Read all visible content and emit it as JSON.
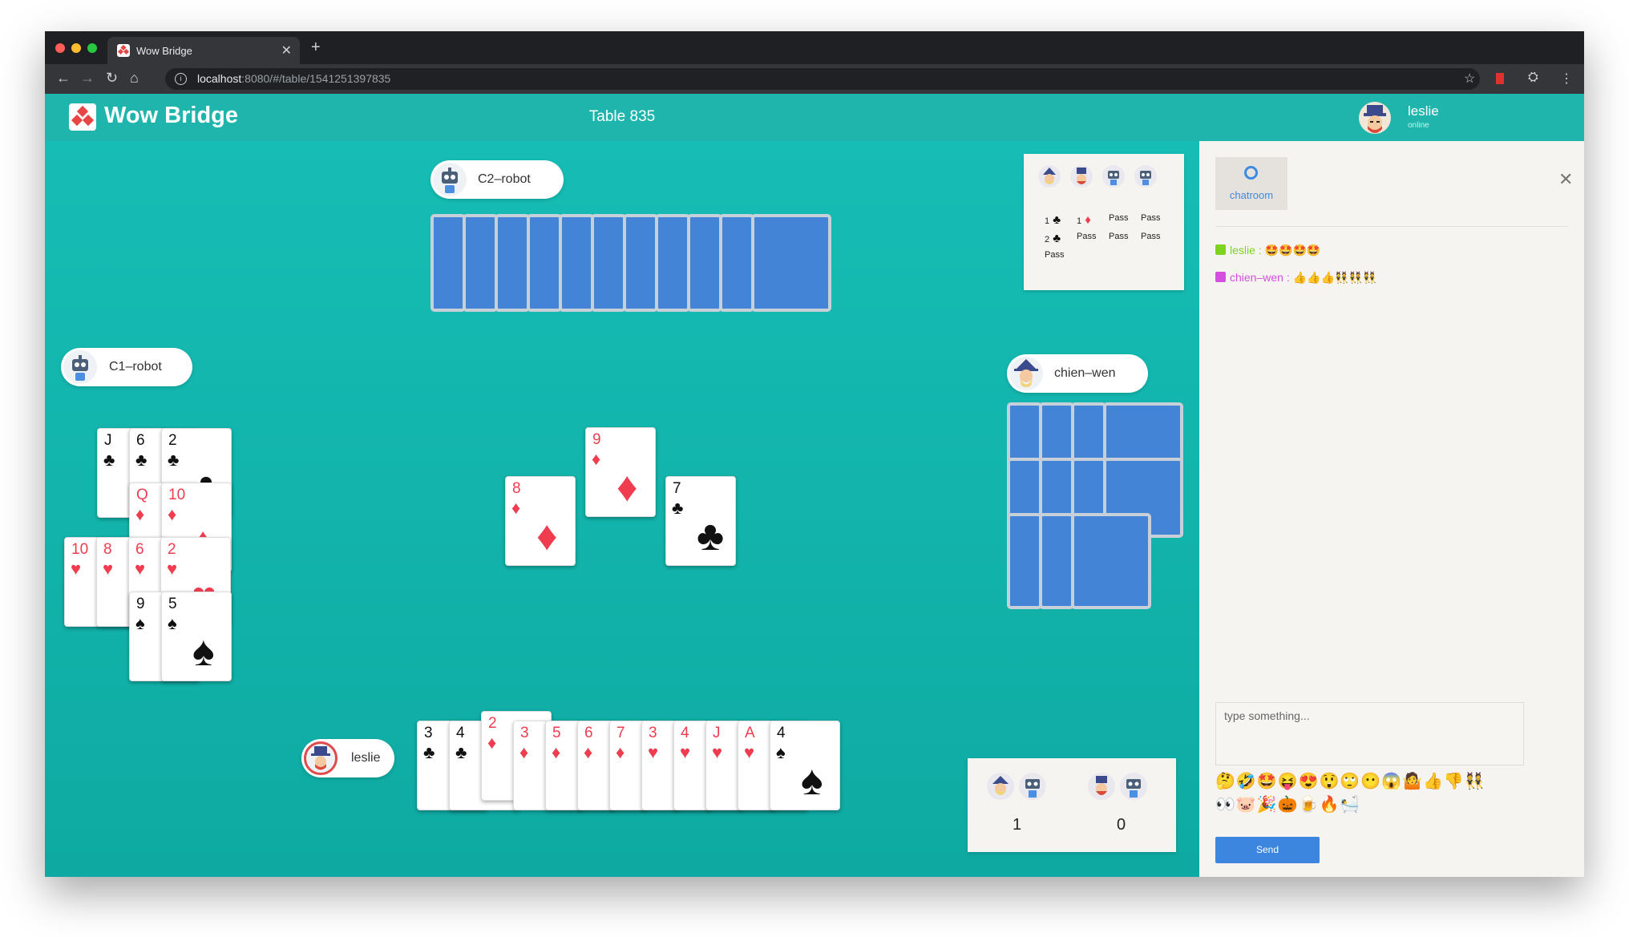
{
  "browser": {
    "tab_title": "Wow Bridge",
    "url_host": "localhost",
    "url_rest": ":8080/#/table/1541251397835"
  },
  "app": {
    "brand": "Wow Bridge",
    "table_title": "Table 835",
    "user_name": "leslie",
    "user_status": "online"
  },
  "players": {
    "north": "C2–robot",
    "west": "C1–robot",
    "east": "chien–wen",
    "south": "leslie"
  },
  "colors": {
    "felt": "#16bdb4",
    "card_back": "#4384d6",
    "red_suit": "#ef3d4f",
    "accent": "#3d86e0"
  },
  "west_hand": [
    {
      "rank": "J",
      "suit": "♣",
      "color": "blk"
    },
    {
      "rank": "6",
      "suit": "♣",
      "color": "blk"
    },
    {
      "rank": "2",
      "suit": "♣",
      "color": "blk"
    },
    {
      "rank": "Q",
      "suit": "♦",
      "color": "red"
    },
    {
      "rank": "10",
      "suit": "♦",
      "color": "red"
    },
    {
      "rank": "10",
      "suit": "♥",
      "color": "red"
    },
    {
      "rank": "8",
      "suit": "♥",
      "color": "red"
    },
    {
      "rank": "6",
      "suit": "♥",
      "color": "red"
    },
    {
      "rank": "2",
      "suit": "♥",
      "color": "red"
    },
    {
      "rank": "9",
      "suit": "♠",
      "color": "blk"
    },
    {
      "rank": "5",
      "suit": "♠",
      "color": "blk"
    }
  ],
  "trick": [
    {
      "rank": "8",
      "suit": "♦",
      "color": "red"
    },
    {
      "rank": "9",
      "suit": "♦",
      "color": "red"
    },
    {
      "rank": "7",
      "suit": "♣",
      "color": "blk"
    }
  ],
  "south_hand": [
    {
      "rank": "3",
      "suit": "♣",
      "color": "blk"
    },
    {
      "rank": "4",
      "suit": "♣",
      "color": "blk"
    },
    {
      "rank": "2",
      "suit": "♦",
      "color": "red"
    },
    {
      "rank": "3",
      "suit": "♦",
      "color": "red"
    },
    {
      "rank": "5",
      "suit": "♦",
      "color": "red"
    },
    {
      "rank": "6",
      "suit": "♦",
      "color": "red"
    },
    {
      "rank": "7",
      "suit": "♦",
      "color": "red"
    },
    {
      "rank": "3",
      "suit": "♥",
      "color": "red"
    },
    {
      "rank": "4",
      "suit": "♥",
      "color": "red"
    },
    {
      "rank": "J",
      "suit": "♥",
      "color": "red"
    },
    {
      "rank": "A",
      "suit": "♥",
      "color": "red"
    },
    {
      "rank": "4",
      "suit": "♠",
      "color": "blk"
    }
  ],
  "bidding": {
    "rows": [
      [
        {
          "text": "1",
          "suit": "♣",
          "color": "blk"
        },
        {
          "text": "1",
          "suit": "♦",
          "color": "red"
        },
        {
          "text": "Pass"
        },
        {
          "text": "Pass"
        }
      ],
      [
        {
          "text": "2",
          "suit": "♣",
          "color": "blk"
        },
        {
          "text": "Pass"
        },
        {
          "text": "Pass"
        },
        {
          "text": "Pass"
        }
      ],
      [
        {
          "text": "Pass"
        }
      ]
    ]
  },
  "score": {
    "team_a": "1",
    "team_b": "0"
  },
  "chat": {
    "tab_label": "chatroom",
    "messages": [
      {
        "user": "leslie",
        "sep": " : ",
        "text": "🤩🤩🤩🤩",
        "color": "#7ed321"
      },
      {
        "user": "chien–wen",
        "sep": " : ",
        "text": "👍👍👍👯👯👯",
        "color": "#d44fe0"
      }
    ],
    "input_placeholder": "type something...",
    "emoji_row1": "🤔🤣🤩😝😍😲🙄😶😱🤷👍👎👯",
    "emoji_row2": "👀🐷🎉🎃🍺🔥🛀",
    "send_label": "Send"
  }
}
